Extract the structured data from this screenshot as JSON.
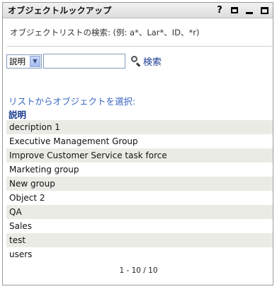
{
  "window": {
    "title": "オブジェクトルックアップ",
    "icons": [
      "help-icon",
      "print-icon",
      "minimize-icon",
      "maximize-icon"
    ],
    "help_glyph": "?"
  },
  "hint": "オブジェクトリストの検索: (例: a*、Lar*、ID、*r)",
  "search": {
    "attribute_selected": "説明",
    "query_value": "",
    "button_label": "検索"
  },
  "list": {
    "caption": "リストからオブジェクトを選択:",
    "column_header": "説明",
    "rows": [
      "decription 1",
      "Executive Management Group",
      "Improve Customer Service task force",
      "Marketing group",
      "New group",
      "Object 2",
      "QA",
      "Sales",
      "test",
      "users"
    ]
  },
  "pager": "1 - 10 / 10",
  "colors": {
    "link_blue": "#1a3c8f",
    "caption_blue": "#3a68c2",
    "row_stripe": "#ebebe6"
  }
}
